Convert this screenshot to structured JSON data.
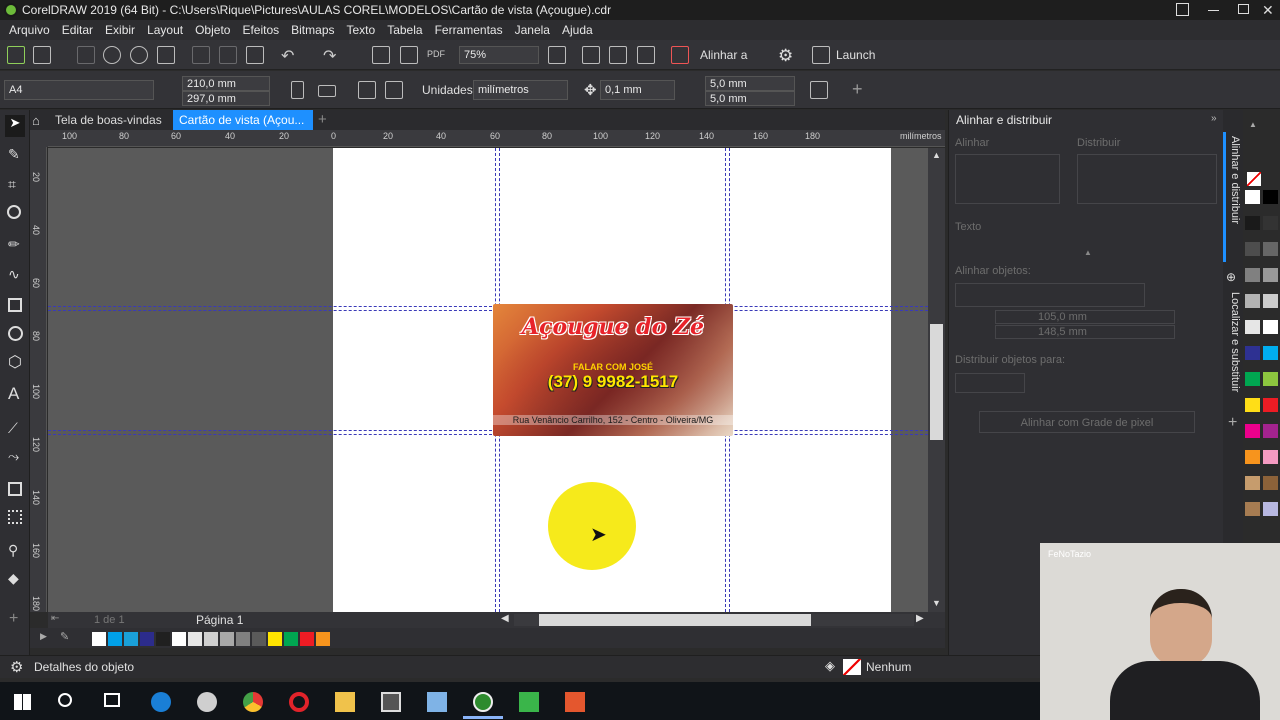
{
  "window": {
    "title": "CorelDRAW 2019 (64 Bit) - C:\\Users\\Rique\\Pictures\\AULAS COREL\\MODELOS\\Cartão de vista (Açougue).cdr"
  },
  "menu": [
    "Arquivo",
    "Editar",
    "Exibir",
    "Layout",
    "Objeto",
    "Efeitos",
    "Bitmaps",
    "Texto",
    "Tabela",
    "Ferramentas",
    "Janela",
    "Ajuda"
  ],
  "toolbar": {
    "zoom": "75%",
    "align_label": "Alinhar a",
    "launch_label": "Launch"
  },
  "props": {
    "page_size": "A4",
    "width": "210,0 mm",
    "height": "297,0 mm",
    "units_label": "Unidades:",
    "units_value": "milímetros",
    "nudge": "0,1 mm",
    "dup_x": "5,0 mm",
    "dup_y": "5,0 mm"
  },
  "tabs": {
    "welcome": "Tela de boas-vindas",
    "doc": "Cartão de vista (Açou..."
  },
  "ruler": {
    "h_labels": [
      "100",
      "80",
      "60",
      "40",
      "20",
      "0",
      "20",
      "40",
      "60",
      "80",
      "100",
      "120",
      "140",
      "160",
      "180"
    ],
    "unit": "milímetros",
    "v_labels": [
      "20",
      "40",
      "60",
      "80",
      "100",
      "120",
      "140",
      "160",
      "180"
    ]
  },
  "card": {
    "brand": "Açougue do Zé",
    "sub": "FALAR COM JOSÉ",
    "phone": "(37) 9 9982-1517",
    "address": "Rua Venâncio Carrilho, 152 - Centro - Oliveira/MG"
  },
  "pagenav": {
    "page_count": "1 de 1",
    "page_label": "Página 1"
  },
  "status": {
    "details": "Detalhes do objeto",
    "fill": "Nenhum"
  },
  "docker": {
    "title": "Alinhar e distribuir",
    "align_section": "Alinhar",
    "distribute_section": "Distribuir",
    "text_section": "Texto",
    "align_objects": "Alinhar objetos:",
    "x_value": "105,0 mm",
    "y_value": "148,5 mm",
    "distribute_to": "Distribuir objetos para:",
    "grid_button": "Alinhar com Grade de pixel"
  },
  "sidetabs": {
    "align": "Alinhar e distribuir",
    "find": "Localizar e substituir"
  },
  "webcam": {
    "label": "FeNoTazio"
  },
  "colors": {
    "accent": "#1e90ff",
    "doc_swatches": [
      "#ffffff",
      "#00a0e8",
      "#1aa0d8",
      "#2c2c8c",
      "#202020",
      "#ffffff",
      "#e6e6e6",
      "#cfcfcf",
      "#a8a8a8",
      "#808080",
      "#5a5a5a",
      "#ffe400",
      "#00a651",
      "#ee1c24",
      "#f7941d"
    ],
    "palette": [
      "#ffffff",
      "#000000",
      "#1a1a1a",
      "#333333",
      "#4d4d4d",
      "#666666",
      "#808080",
      "#999999",
      "#b3b3b3",
      "#cccccc",
      "#e6e6e6",
      "#ffffff",
      "#2e3192",
      "#00aeef",
      "#00a651",
      "#8dc63f",
      "#ffde17",
      "#ed1c24",
      "#ec008c",
      "#a3238e",
      "#f7941d",
      "#f49ac1",
      "#c69c6d",
      "#8c6239",
      "#a67c52",
      "#b7b7e0"
    ]
  }
}
